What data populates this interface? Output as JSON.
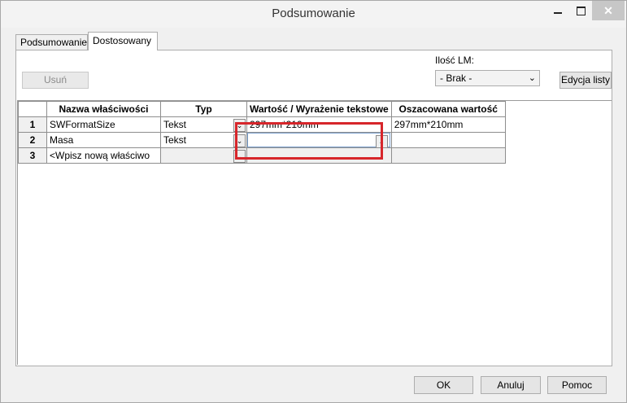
{
  "window": {
    "title": "Podsumowanie",
    "close_glyph": "✕"
  },
  "tabs": [
    {
      "label": "Podsumowanie"
    },
    {
      "label": "Dostosowany"
    }
  ],
  "toolbar": {
    "delete_label": "Usuń",
    "lm_label": "Ilość LM:",
    "lm_selected": "- Brak -",
    "edit_list_label": "Edycja listy"
  },
  "grid": {
    "headers": [
      "Nazwa właściwości",
      "Typ",
      "Wartość / Wyrażenie tekstowe",
      "Oszacowana wartość"
    ],
    "rows": [
      {
        "num": "1",
        "name": "SWFormatSize",
        "type": "Tekst",
        "value": "297mm*210mm",
        "estimated": "297mm*210mm"
      },
      {
        "num": "2",
        "name": "Masa",
        "type": "Tekst",
        "value": "",
        "estimated": ""
      },
      {
        "num": "3",
        "name": "<Wpisz nową właściwo",
        "type": "",
        "value": "",
        "estimated": ""
      }
    ]
  },
  "footer": {
    "ok_label": "OK",
    "cancel_label": "Anuluj",
    "help_label": "Pomoc"
  },
  "colors": {
    "highlight": "#d7262b",
    "close_button": "#c7c7c7",
    "combo_border": "#7da2ce"
  },
  "icons": [
    "minimize-icon",
    "maximize-icon",
    "close-icon",
    "chevron-down-icon"
  ]
}
